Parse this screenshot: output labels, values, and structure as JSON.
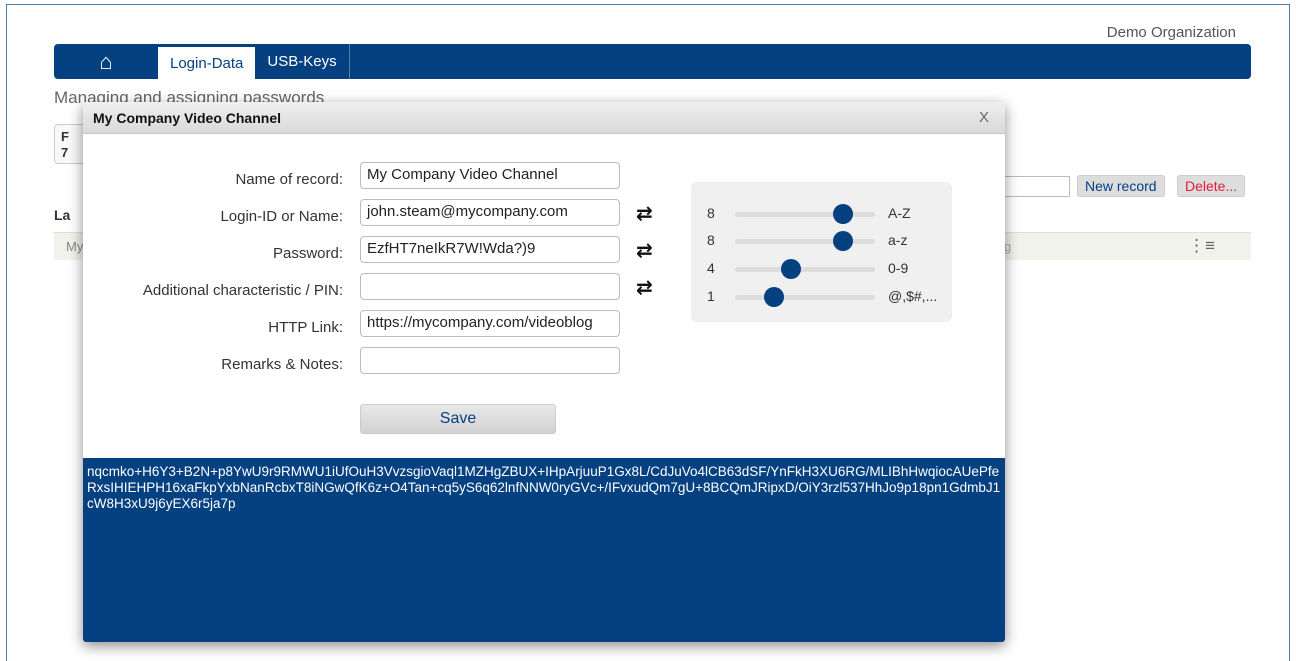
{
  "org": "Demo Organization",
  "nav": {
    "home_icon": "home-icon",
    "tabs": [
      {
        "label": "Login-Data",
        "active": true
      },
      {
        "label": "USB-Keys",
        "active": false
      }
    ]
  },
  "page": {
    "subtitle": "Managing and assigning passwords",
    "card_text": "F\n7",
    "new_record": "New record",
    "delete": "Delete...",
    "list_header": "La",
    "row_text": "My",
    "row_text2": "g"
  },
  "dialog": {
    "title": "My Company Video Channel",
    "close": "X",
    "fields": [
      {
        "label": "Name of record:",
        "value": "My Company Video Channel",
        "shuffle": false
      },
      {
        "label": "Login-ID or Name:",
        "value": "john.steam@mycompany.com",
        "shuffle": true
      },
      {
        "label": "Password:",
        "value": "EzfHT7neIkR7W!Wda?)9",
        "shuffle": true
      },
      {
        "label": "Additional characteristic / PIN:",
        "value": "",
        "shuffle": true
      },
      {
        "label": "HTTP Link:",
        "value": "https://mycompany.com/videoblog",
        "shuffle": false
      },
      {
        "label": "Remarks & Notes:",
        "value": "",
        "shuffle": false
      }
    ],
    "save": "Save",
    "sliders": [
      {
        "count": "8",
        "class": "A-Z",
        "level": 0.77
      },
      {
        "count": "8",
        "class": "a-z",
        "level": 0.77
      },
      {
        "count": "4",
        "class": "0-9",
        "level": 0.4
      },
      {
        "count": "1",
        "class": "@,$#,...",
        "level": 0.28
      }
    ],
    "generated": "nqcmko+H6Y3+B2N+p8YwU9r9RMWU1iUfOuH3VvzsgioVaql1MZHgZBUX+IHpArjuuP1Gx8L/CdJuVo4lCB63dSF/YnFkH3XU6RG/MLIBhHwqiocAUePfeRxsIHIEHPH16xaFkpYxbNanRcbxT8iNGwQfK6z+O4Tan+cq5yS6q62lnfNNW0ryGVc+/IFvxudQm7gU+8BCQmJRipxD/OiY3rzl537HhJo9p18pn1GdmbJ1cW8H3xU9j6yEX6r5ja7p"
  },
  "colors": {
    "brand": "#054081",
    "delete": "#e01e3c"
  }
}
